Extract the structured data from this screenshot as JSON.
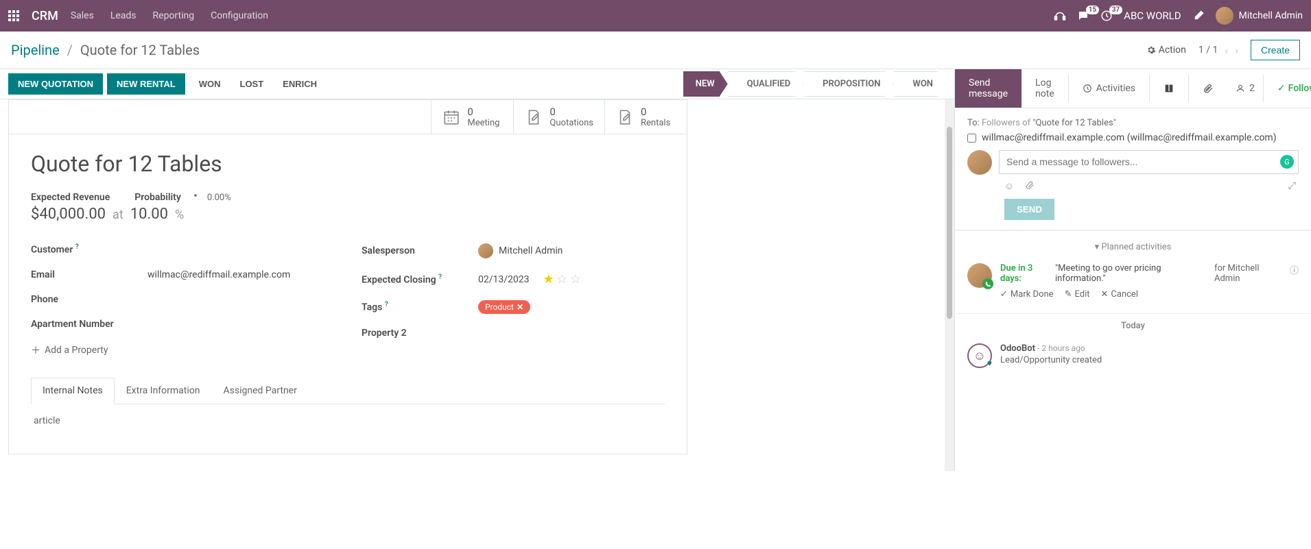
{
  "nav": {
    "brand": "CRM",
    "menu": [
      "Sales",
      "Leads",
      "Reporting",
      "Configuration"
    ],
    "discuss_count": "15",
    "activity_count": "37",
    "company": "ABC WORLD",
    "user": "Mitchell Admin"
  },
  "breadcrumb": {
    "root": "Pipeline",
    "current": "Quote for 12 Tables"
  },
  "controls": {
    "action": "Action",
    "pager": "1 / 1",
    "create": "Create"
  },
  "status": {
    "new_quotation": "NEW QUOTATION",
    "new_rental": "NEW RENTAL",
    "won": "WON",
    "lost": "LOST",
    "enrich": "ENRICH",
    "stages": [
      "NEW",
      "QUALIFIED",
      "PROPOSITION",
      "WON"
    ],
    "active_stage_index": 0
  },
  "stat_buttons": {
    "meeting": {
      "count": "0",
      "label": "Meeting"
    },
    "quotations": {
      "count": "0",
      "label": "Quotations"
    },
    "rentals": {
      "count": "0",
      "label": "Rentals"
    }
  },
  "record": {
    "title": "Quote for 12 Tables",
    "expected_revenue_label": "Expected Revenue",
    "expected_revenue": "$40,000.00",
    "at": "at",
    "probability_label": "Probability",
    "probability_pct": "0.00%",
    "probability_val": "10.00",
    "pct_sign": "%",
    "fields_left": {
      "customer": {
        "label": "Customer"
      },
      "email": {
        "label": "Email",
        "value": "willmac@rediffmail.example.com"
      },
      "phone": {
        "label": "Phone"
      },
      "apt": {
        "label": "Apartment Number"
      }
    },
    "fields_right": {
      "salesperson": {
        "label": "Salesperson",
        "value": "Mitchell Admin"
      },
      "closing": {
        "label": "Expected Closing",
        "value": "02/13/2023"
      },
      "tags": {
        "label": "Tags",
        "value": "Product"
      },
      "property2": {
        "label": "Property 2"
      }
    },
    "add_property": "Add a Property"
  },
  "tabs": {
    "notes": "Internal Notes",
    "extra": "Extra Information",
    "partner": "Assigned Partner",
    "notes_content": "article"
  },
  "chatter": {
    "send_message": "Send message",
    "log_note": "Log note",
    "activities": "Activities",
    "followers_count": "2",
    "following": "Following",
    "to_prefix": "To:",
    "to_sub": "Followers of",
    "to_doc": "\"Quote for 12 Tables\"",
    "recipient": "willmac@rediffmail.example.com (willmac@rediffmail.example.com)",
    "placeholder": "Send a message to followers...",
    "send": "SEND",
    "planned_activities": "Planned activities",
    "activity": {
      "due": "Due in 3 days:",
      "summary": "\"Meeting to go over pricing information.\"",
      "for": "for Mitchell Admin",
      "mark_done": "Mark Done",
      "edit": "Edit",
      "cancel": "Cancel"
    },
    "today": "Today",
    "message": {
      "author": "OdooBot",
      "time": "- 2 hours ago",
      "body": "Lead/Opportunity created"
    }
  }
}
